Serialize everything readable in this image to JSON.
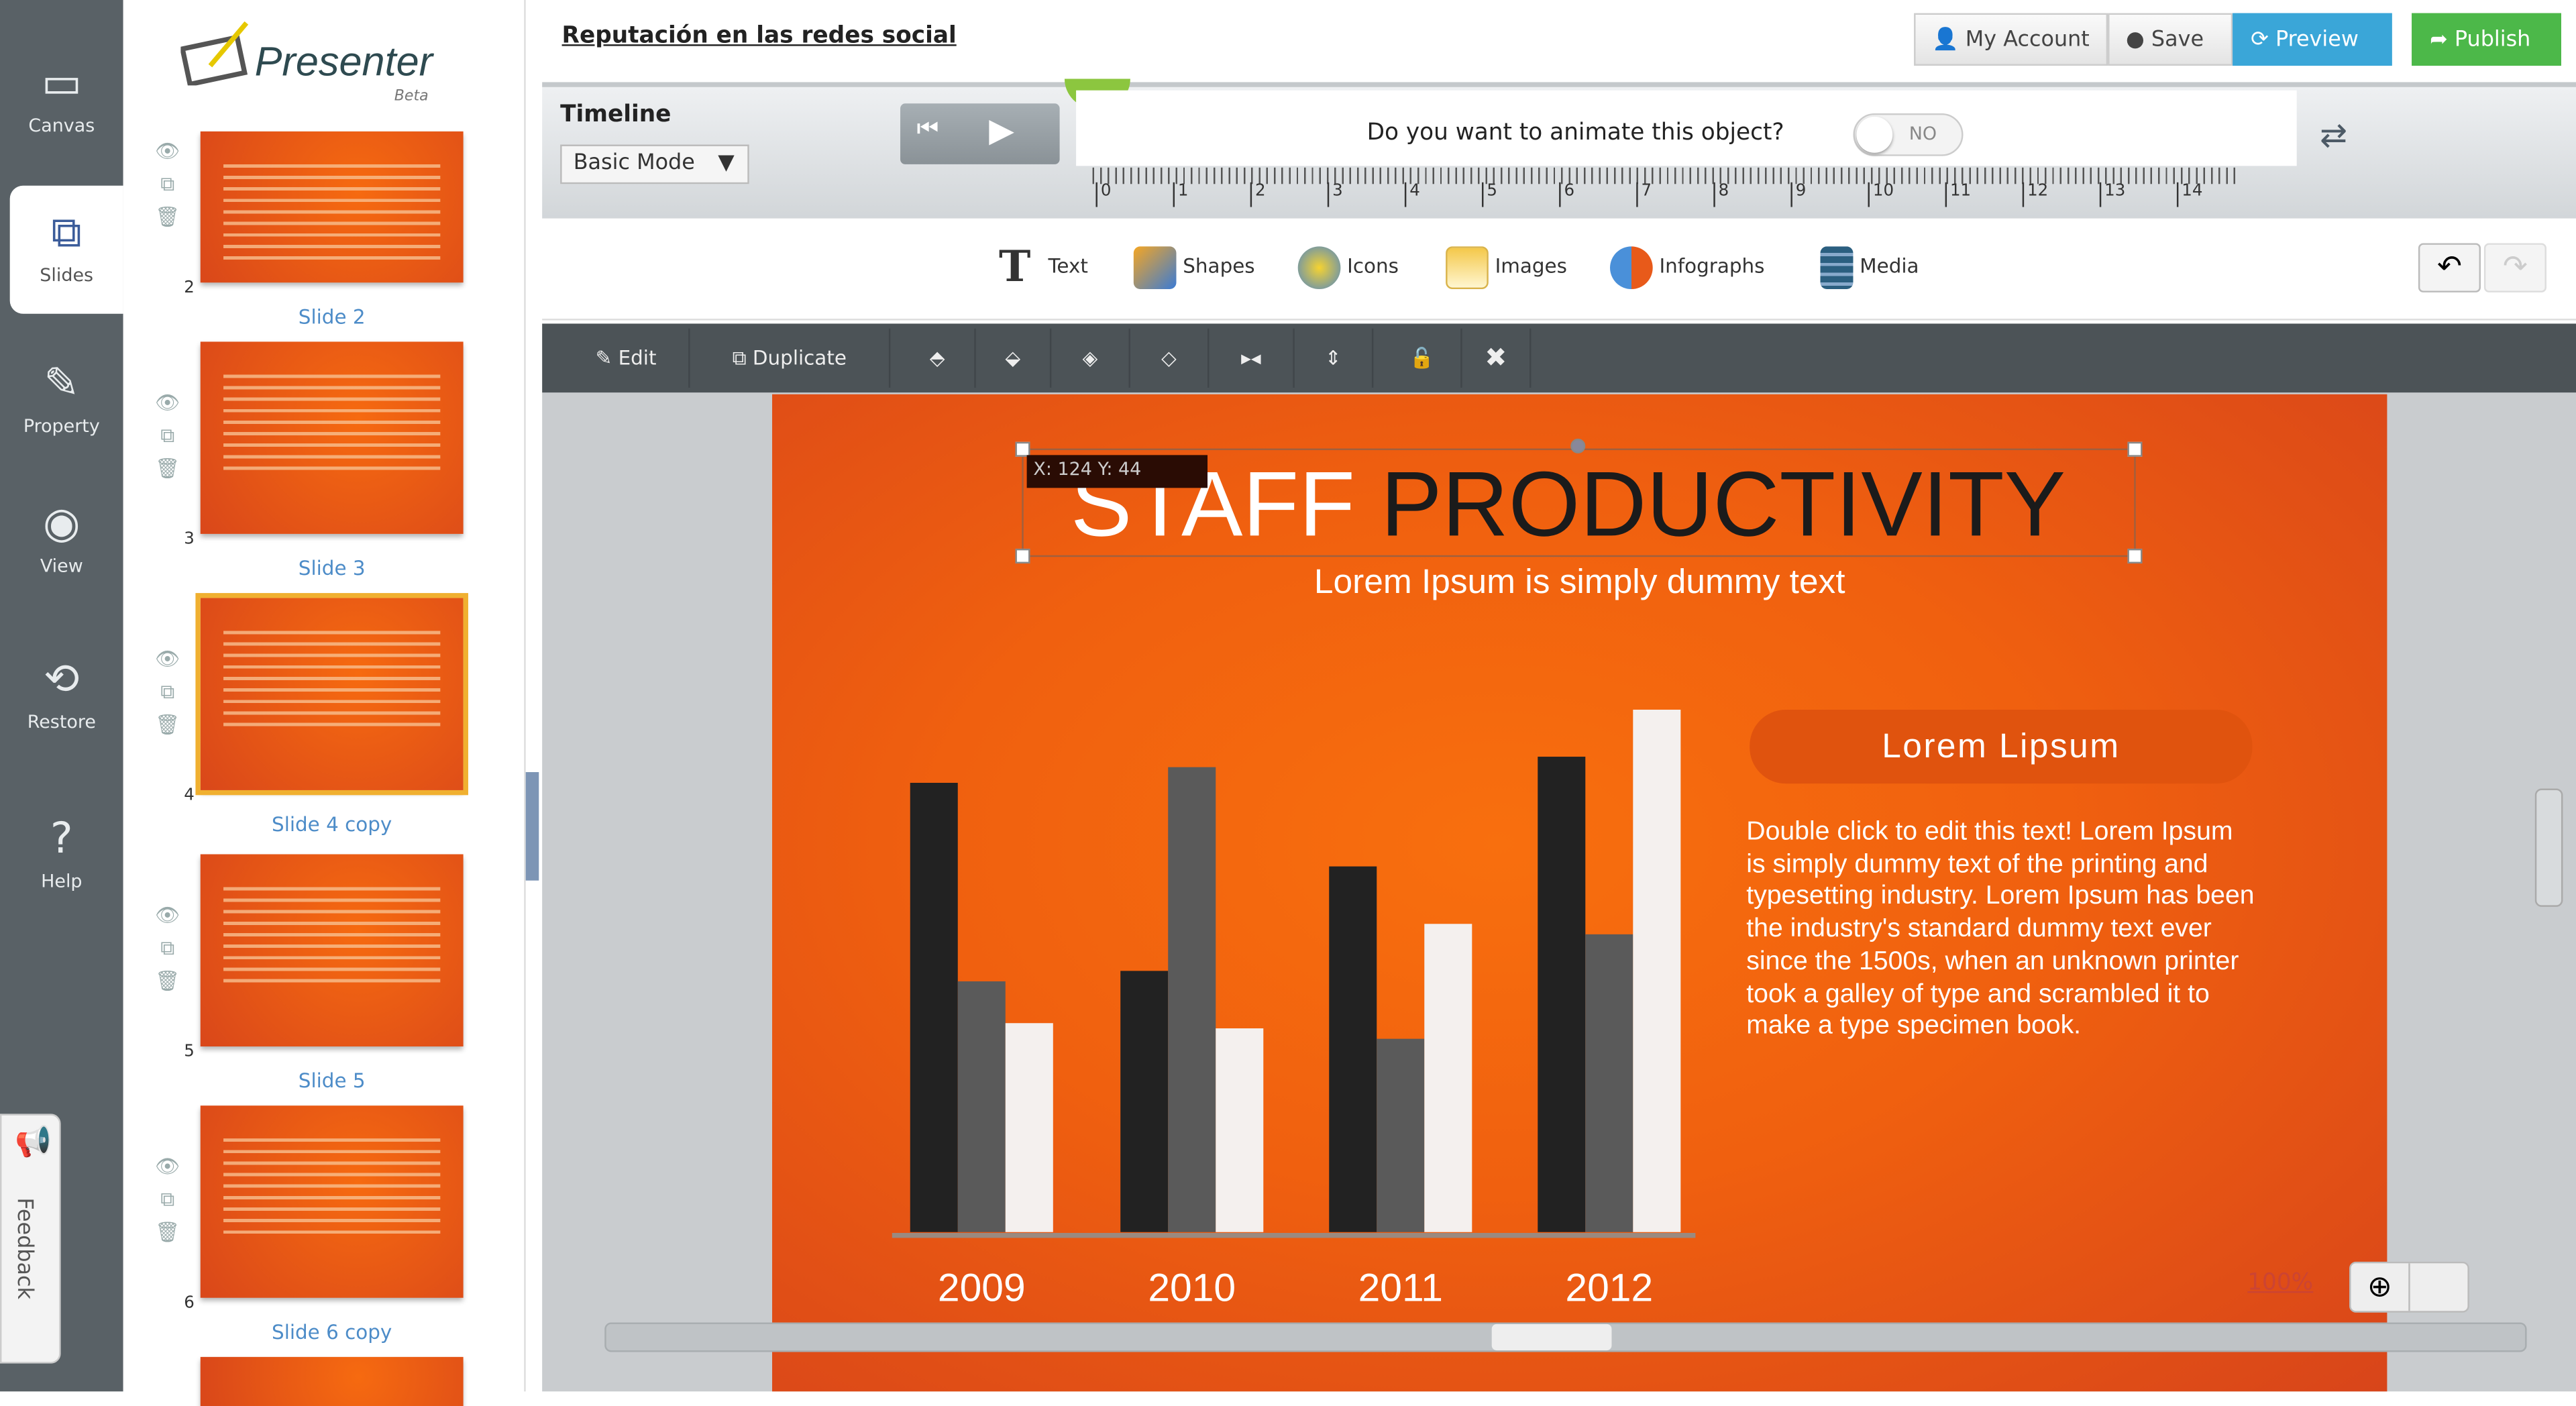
{
  "nav": {
    "items": [
      {
        "label": "Canvas",
        "icon": "canvas-icon"
      },
      {
        "label": "Slides",
        "icon": "slides-icon",
        "active": true
      },
      {
        "label": "Property",
        "icon": "pencil-icon"
      },
      {
        "label": "View",
        "icon": "eye-icon"
      },
      {
        "label": "Restore",
        "icon": "restore-icon"
      },
      {
        "label": "Help",
        "icon": "help-icon"
      }
    ],
    "feedback": "Feedback"
  },
  "logo": {
    "name": "Presenter",
    "tag": "Beta"
  },
  "slides": [
    {
      "num": "2",
      "label": "Slide 2"
    },
    {
      "num": "3",
      "label": "Slide 3"
    },
    {
      "num": "4",
      "label": "Slide 4 copy",
      "selected": true
    },
    {
      "num": "5",
      "label": "Slide 5"
    },
    {
      "num": "6",
      "label": "Slide 6 copy"
    }
  ],
  "doc_title": "Reputación en las redes social",
  "top_buttons": {
    "account": "My Account",
    "save": "Save",
    "preview": "Preview",
    "publish": "Publish"
  },
  "colors": {
    "preview": "#3aa6d8",
    "publish": "#4cb849",
    "slide": "#f26a10",
    "nav": "#596166"
  },
  "timeline": {
    "label": "Timeline",
    "mode": "Basic Mode",
    "question": "Do you want to animate this object?",
    "toggle": "NO",
    "ruler": [
      "0",
      "1",
      "2",
      "3",
      "4",
      "5",
      "6",
      "7",
      "8",
      "9",
      "10",
      "11",
      "12",
      "13",
      "14"
    ]
  },
  "insert": {
    "text": "Text",
    "shapes": "Shapes",
    "icons": "Icons",
    "images": "Images",
    "infographs": "Infographs",
    "media": "Media"
  },
  "editbar": {
    "edit": "Edit",
    "duplicate": "Duplicate"
  },
  "slide": {
    "coord": "X: 124 Y: 44",
    "title_a": "STAFF",
    "title_b": "PRODUCTIVITY",
    "subtitle": "Lorem Ipsum is simply dummy text",
    "pill": "Lorem Lipsum",
    "body": "Double click to edit this text! Lorem Ipsum is simply dummy text of the printing and typesetting industry. Lorem Ipsum has been the industry's standard dummy text ever since the 1500s, when an unknown printer took a galley of type and scrambled it to make a type specimen book."
  },
  "zoom": {
    "level": "100%"
  },
  "chart_data": {
    "type": "bar",
    "categories": [
      "2009",
      "2010",
      "2011",
      "2012"
    ],
    "series": [
      {
        "values": [
          86,
          50,
          70,
          91
        ],
        "color": "#222222"
      },
      {
        "values": [
          48,
          89,
          37,
          57
        ],
        "color": "#5a5a5a"
      },
      {
        "values": [
          40,
          39,
          59,
          100
        ],
        "color": "#f4f0ee"
      }
    ],
    "ylim": [
      0,
      100
    ],
    "grid": false
  }
}
